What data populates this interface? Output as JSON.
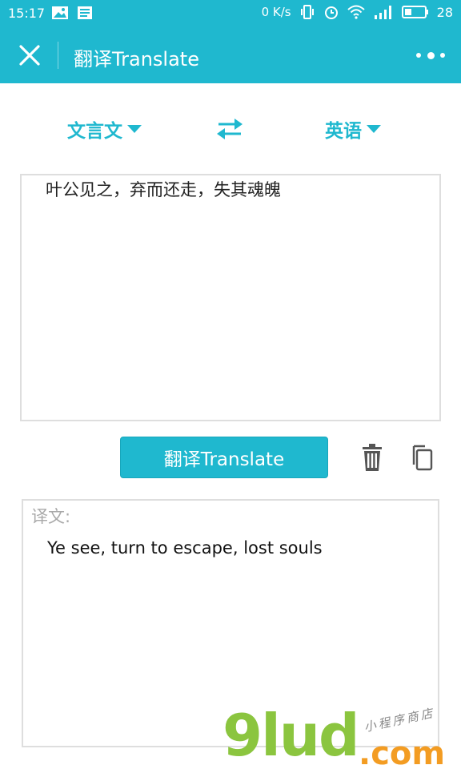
{
  "status_bar": {
    "time": "15:17",
    "network_speed": "0 K/s",
    "battery": "28",
    "icons": [
      "image-icon",
      "document-icon",
      "vibrate-icon",
      "alarm-icon",
      "wifi-icon",
      "signal-4g-icon",
      "battery-icon"
    ]
  },
  "header": {
    "title": "翻译Translate",
    "close_icon": "close-icon",
    "more_icon": "more-icon"
  },
  "languages": {
    "source": "文言文",
    "target": "英语",
    "swap_icon": "swap-arrows-icon"
  },
  "input": {
    "text": "叶公见之，弃而还走，失其魂魄"
  },
  "actions": {
    "translate_label": "翻译Translate",
    "delete_icon": "trash-icon",
    "copy_icon": "copy-icon"
  },
  "output": {
    "label": "译文:",
    "text": "Ye see, turn to escape, lost souls"
  },
  "watermark": {
    "main": "9lud",
    "suffix": ".com",
    "tagline": "小程序商店"
  },
  "colors": {
    "accent": "#1fb8cf",
    "watermark_green": "#8bc53f",
    "watermark_orange": "#f39c22"
  }
}
